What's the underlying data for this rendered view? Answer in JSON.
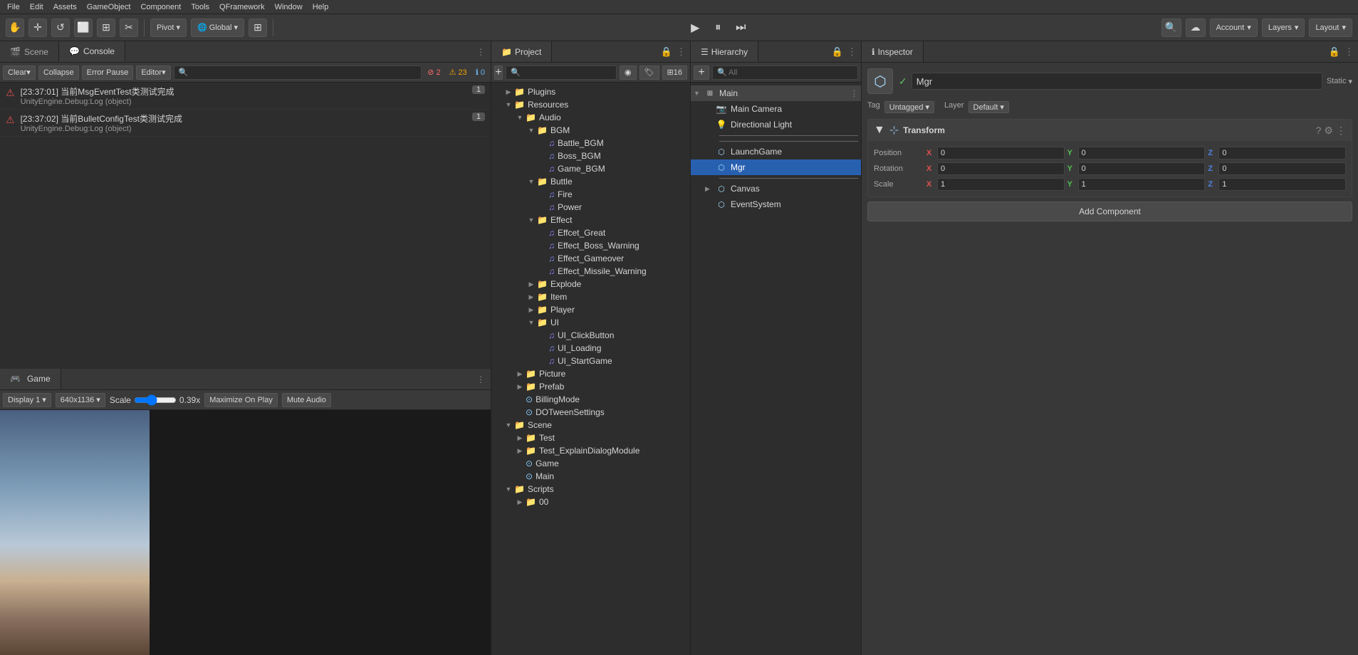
{
  "menubar": {
    "items": [
      "File",
      "Edit",
      "Assets",
      "GameObject",
      "Component",
      "Tools",
      "QFramework",
      "Window",
      "Help"
    ]
  },
  "toolbar": {
    "tools": [
      "✋",
      "✛",
      "↺",
      "⬜",
      "🌐",
      "✂"
    ],
    "pivot_label": "Pivot",
    "global_label": "Global",
    "grid_icon": "⊞",
    "play_icon": "▶",
    "pause_icon": "⏸",
    "step_icon": "⏭",
    "collab_icon": "☁",
    "account_label": "Account",
    "layers_label": "Layers",
    "layout_label": "Layout"
  },
  "console": {
    "tab_label": "Console",
    "scene_label": "Scene",
    "clear_label": "Clear",
    "collapse_label": "Collapse",
    "error_pause_label": "Error Pause",
    "editor_label": "Editor",
    "search_placeholder": "🔍",
    "error_count": "2",
    "warn_count": "23",
    "info_count": "0",
    "messages": [
      {
        "type": "error",
        "icon": "⚠",
        "line1": "[23:37:01] 当前MsgEventTest类测试完成",
        "line2": "UnityEngine.Debug:Log (object)",
        "count": "1"
      },
      {
        "type": "error",
        "icon": "⚠",
        "line1": "[23:37:02] 当前BulletConfigTest类测试完成",
        "line2": "UnityEngine.Debug:Log (object)",
        "count": "1"
      }
    ]
  },
  "game": {
    "tab_label": "Game",
    "display_label": "Display 1",
    "resolution_label": "640x1136",
    "scale_label": "Scale",
    "scale_value": "0.39x",
    "maximize_label": "Maximize On Play",
    "mute_label": "Mute Audio"
  },
  "project": {
    "tab_label": "Project",
    "tree": [
      {
        "label": "Plugins",
        "type": "folder",
        "depth": 0,
        "expanded": false
      },
      {
        "label": "Resources",
        "type": "folder",
        "depth": 0,
        "expanded": true
      },
      {
        "label": "Audio",
        "type": "folder",
        "depth": 1,
        "expanded": true
      },
      {
        "label": "BGM",
        "type": "folder",
        "depth": 2,
        "expanded": true
      },
      {
        "label": "Battle_BGM",
        "type": "audio",
        "depth": 3
      },
      {
        "label": "Boss_BGM",
        "type": "audio",
        "depth": 3
      },
      {
        "label": "Game_BGM",
        "type": "audio",
        "depth": 3
      },
      {
        "label": "Buttle",
        "type": "folder",
        "depth": 2,
        "expanded": true
      },
      {
        "label": "Fire",
        "type": "audio",
        "depth": 3
      },
      {
        "label": "Power",
        "type": "audio",
        "depth": 3
      },
      {
        "label": "Effect",
        "type": "folder",
        "depth": 2,
        "expanded": true
      },
      {
        "label": "Effcet_Great",
        "type": "audio",
        "depth": 3
      },
      {
        "label": "Effect_Boss_Warning",
        "type": "audio",
        "depth": 3
      },
      {
        "label": "Effect_Gameover",
        "type": "audio",
        "depth": 3
      },
      {
        "label": "Effect_Missile_Warning",
        "type": "audio",
        "depth": 3
      },
      {
        "label": "Explode",
        "type": "folder",
        "depth": 2,
        "expanded": false
      },
      {
        "label": "Item",
        "type": "folder",
        "depth": 2,
        "expanded": false
      },
      {
        "label": "Player",
        "type": "folder",
        "depth": 2,
        "expanded": false
      },
      {
        "label": "UI",
        "type": "folder",
        "depth": 2,
        "expanded": true
      },
      {
        "label": "UI_ClickButton",
        "type": "audio",
        "depth": 3
      },
      {
        "label": "UI_Loading",
        "type": "audio",
        "depth": 3
      },
      {
        "label": "UI_StartGame",
        "type": "audio",
        "depth": 3
      },
      {
        "label": "Picture",
        "type": "folder",
        "depth": 1,
        "expanded": false
      },
      {
        "label": "Prefab",
        "type": "folder",
        "depth": 1,
        "expanded": false
      },
      {
        "label": "BillingMode",
        "type": "folder",
        "depth": 1,
        "expanded": false
      },
      {
        "label": "DOTweenSettings",
        "type": "scene",
        "depth": 1
      },
      {
        "label": "Scene",
        "type": "folder",
        "depth": 0,
        "expanded": true
      },
      {
        "label": "Test",
        "type": "folder",
        "depth": 1,
        "expanded": false
      },
      {
        "label": "Test_ExplainDialogModule",
        "type": "folder",
        "depth": 1,
        "expanded": false
      },
      {
        "label": "Game",
        "type": "scene",
        "depth": 1
      },
      {
        "label": "Main",
        "type": "scene",
        "depth": 1
      },
      {
        "label": "Scripts",
        "type": "folder",
        "depth": 0,
        "expanded": true
      },
      {
        "label": "00",
        "type": "folder",
        "depth": 1,
        "expanded": false
      }
    ]
  },
  "hierarchy": {
    "tab_label": "Hierarchy",
    "search_placeholder": "🔍 All",
    "add_label": "+",
    "tree": [
      {
        "label": "Main",
        "type": "group",
        "depth": 0,
        "expanded": true,
        "selected": false
      },
      {
        "label": "Main Camera",
        "type": "camera",
        "depth": 1,
        "selected": false
      },
      {
        "label": "Directional Light",
        "type": "light",
        "depth": 1,
        "selected": false
      },
      {
        "label": "separator1",
        "type": "separator",
        "depth": 1
      },
      {
        "label": "separator2",
        "type": "separator",
        "depth": 1
      },
      {
        "label": "LaunchGame",
        "type": "object",
        "depth": 1,
        "selected": false
      },
      {
        "label": "Mgr",
        "type": "object",
        "depth": 1,
        "selected": true
      },
      {
        "label": "separator3",
        "type": "separator",
        "depth": 1
      },
      {
        "label": "Canvas",
        "type": "canvas",
        "depth": 1,
        "selected": false,
        "expanded": false
      },
      {
        "label": "EventSystem",
        "type": "event",
        "depth": 1,
        "selected": false
      }
    ]
  },
  "inspector": {
    "tab_label": "Inspector",
    "obj_name": "Mgr",
    "is_static": "Static",
    "tag_label": "Tag",
    "tag_value": "Untagged",
    "layer_label": "Layer",
    "layer_value": "Default",
    "transform_label": "Transform",
    "position_label": "Position",
    "rotation_label": "Rotation",
    "scale_label": "Scale",
    "pos_x": "0",
    "pos_y": "0",
    "pos_z": "0",
    "rot_x": "0",
    "rot_y": "0",
    "rot_z": "0",
    "scale_x": "1",
    "scale_y": "1",
    "scale_z": "1",
    "add_component_label": "Add Component"
  }
}
